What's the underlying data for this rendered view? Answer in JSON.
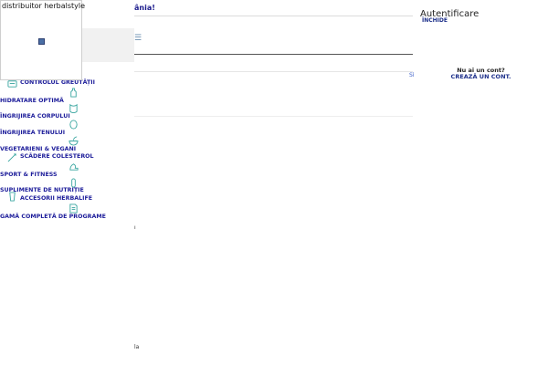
{
  "background": {
    "headline": "ânia!",
    "si_fragment": "Sì",
    "fragment_a": "ı",
    "fragment_b": "la",
    "menu_glyph": "☰"
  },
  "popup": {
    "title": "distribuitor herbalstyle",
    "image_icon": "broken-image-icon"
  },
  "categories": [
    {
      "label": "CONTROLUL GREUTĂȚII",
      "icon": "scale-icon"
    },
    {
      "label": "HIDRATARE OPTIMĂ",
      "icon": "bottle-icon"
    },
    {
      "label": "ÎNGRIJIREA CORPULUI",
      "icon": "body-icon"
    },
    {
      "label": "ÎNGRIJIREA TENULUI",
      "icon": "face-icon"
    },
    {
      "label": "VEGETARIENI & VEGANI",
      "icon": "leaf-bowl-icon"
    },
    {
      "label": "SCĂDERE COLESTEROL",
      "icon": "heart-pulse-icon"
    },
    {
      "label": "SPORT & FITNESS",
      "icon": "muscle-icon"
    },
    {
      "label": "SUPLIMENTE DE NUTRIȚIE",
      "icon": "capsule-icon"
    },
    {
      "label": "ACCESORII HERBALIFE",
      "icon": "shaker-icon"
    },
    {
      "label": "GAMĂ COMPLETĂ DE PROGRAME",
      "icon": "document-icon"
    }
  ],
  "auth": {
    "title": "Autentificare",
    "close_label": "ÎNCHIDE",
    "no_account": "Nu ai un cont?",
    "create_account": "CREAZĂ UN CONT."
  }
}
